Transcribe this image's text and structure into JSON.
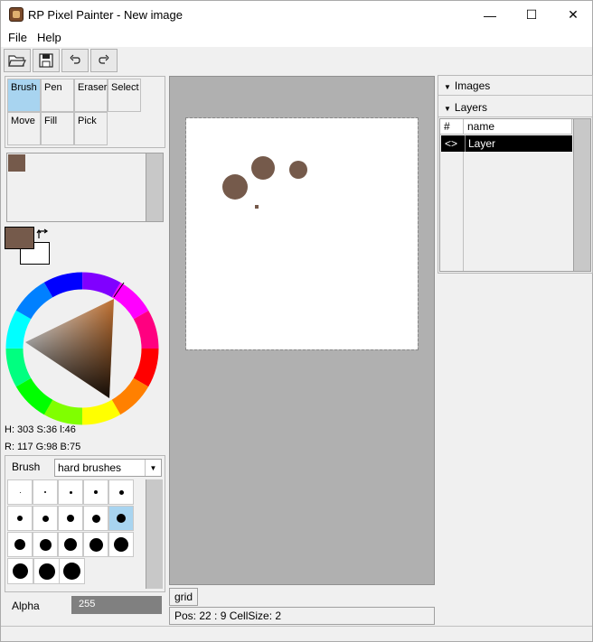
{
  "window": {
    "title": "RP Pixel Painter - New image",
    "minimize": "—",
    "maximize": "☐",
    "close": "✕"
  },
  "menu": [
    "File",
    "Help"
  ],
  "toolbar": {
    "icons": [
      "folder-open-icon",
      "save-icon",
      "undo-icon",
      "redo-icon"
    ]
  },
  "tools": [
    {
      "label": "Brush",
      "active": true
    },
    {
      "label": "Pen",
      "active": false
    },
    {
      "label": "Eraser",
      "active": false
    },
    {
      "label": "Select",
      "active": false
    },
    {
      "label": "Move",
      "active": false
    },
    {
      "label": "Fill",
      "active": false
    },
    {
      "label": "Pick",
      "active": false
    }
  ],
  "colors": {
    "primary": "#755a4b",
    "secondary": "#ffffff"
  },
  "color_info": {
    "hsl": "H: 303 S:36 l:46",
    "rgb": "R: 117 G:98 B:75"
  },
  "brush": {
    "label": "Brush",
    "preset": "hard brushes",
    "selected_index": 9
  },
  "alpha": {
    "label": "Alpha",
    "value": "255"
  },
  "canvas": {
    "grid_label": "grid",
    "status": "Pos: 22 : 9 CellSize: 2"
  },
  "panels": {
    "images_label": "Images",
    "layers_label": "Layers",
    "col_hash": "#",
    "col_name": "name",
    "layer_name": "Layer",
    "layer_visibility": "<>"
  }
}
